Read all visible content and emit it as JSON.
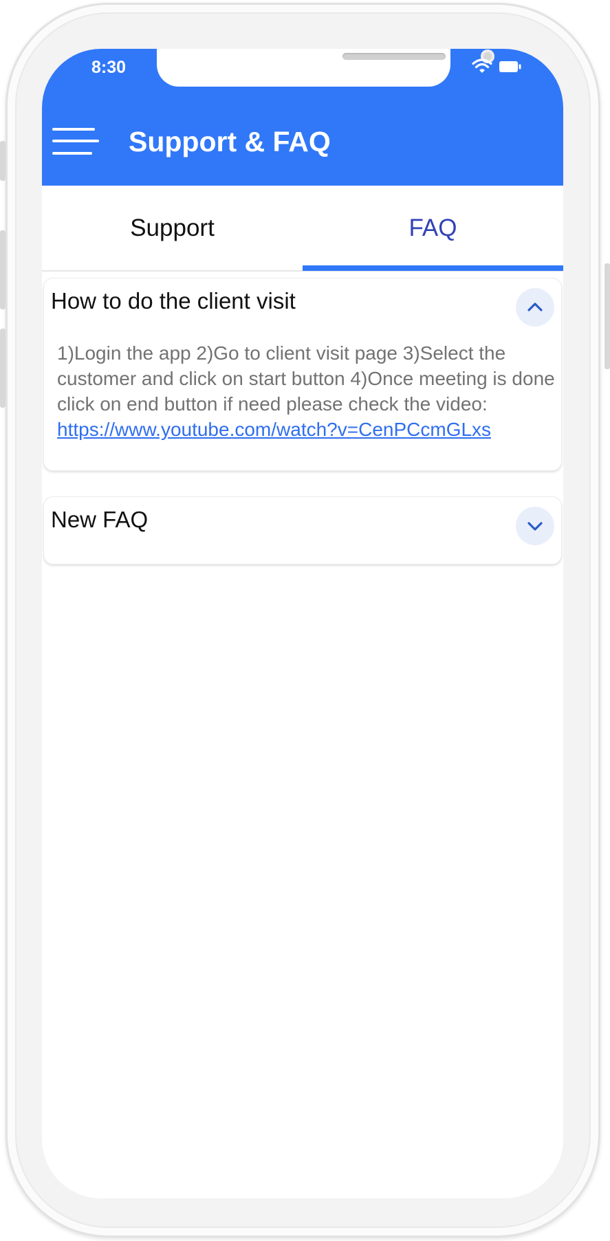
{
  "status_bar": {
    "time": "8:30"
  },
  "app_bar": {
    "title": "Support & FAQ"
  },
  "tabs": [
    {
      "label": "Support",
      "selected": false
    },
    {
      "label": "FAQ",
      "selected": true
    }
  ],
  "faqs": [
    {
      "question": "How to do the client visit",
      "expanded": true,
      "answer_text": "1)Login the app 2)Go to client visit page 3)Select the customer and click on start button 4)Once meeting is done click on end button if need please check the video: ",
      "answer_link": "https://www.youtube.com/watch?v=CenPCcmGLxs"
    },
    {
      "question": "New FAQ",
      "expanded": false
    }
  ],
  "colors": {
    "primary": "#3178f8",
    "tab_active": "#3142b6",
    "link": "#2f6ef0"
  },
  "icons": {
    "menu": "hamburger-menu-icon",
    "expand": "chevron-down-icon",
    "collapse": "chevron-up-icon"
  }
}
